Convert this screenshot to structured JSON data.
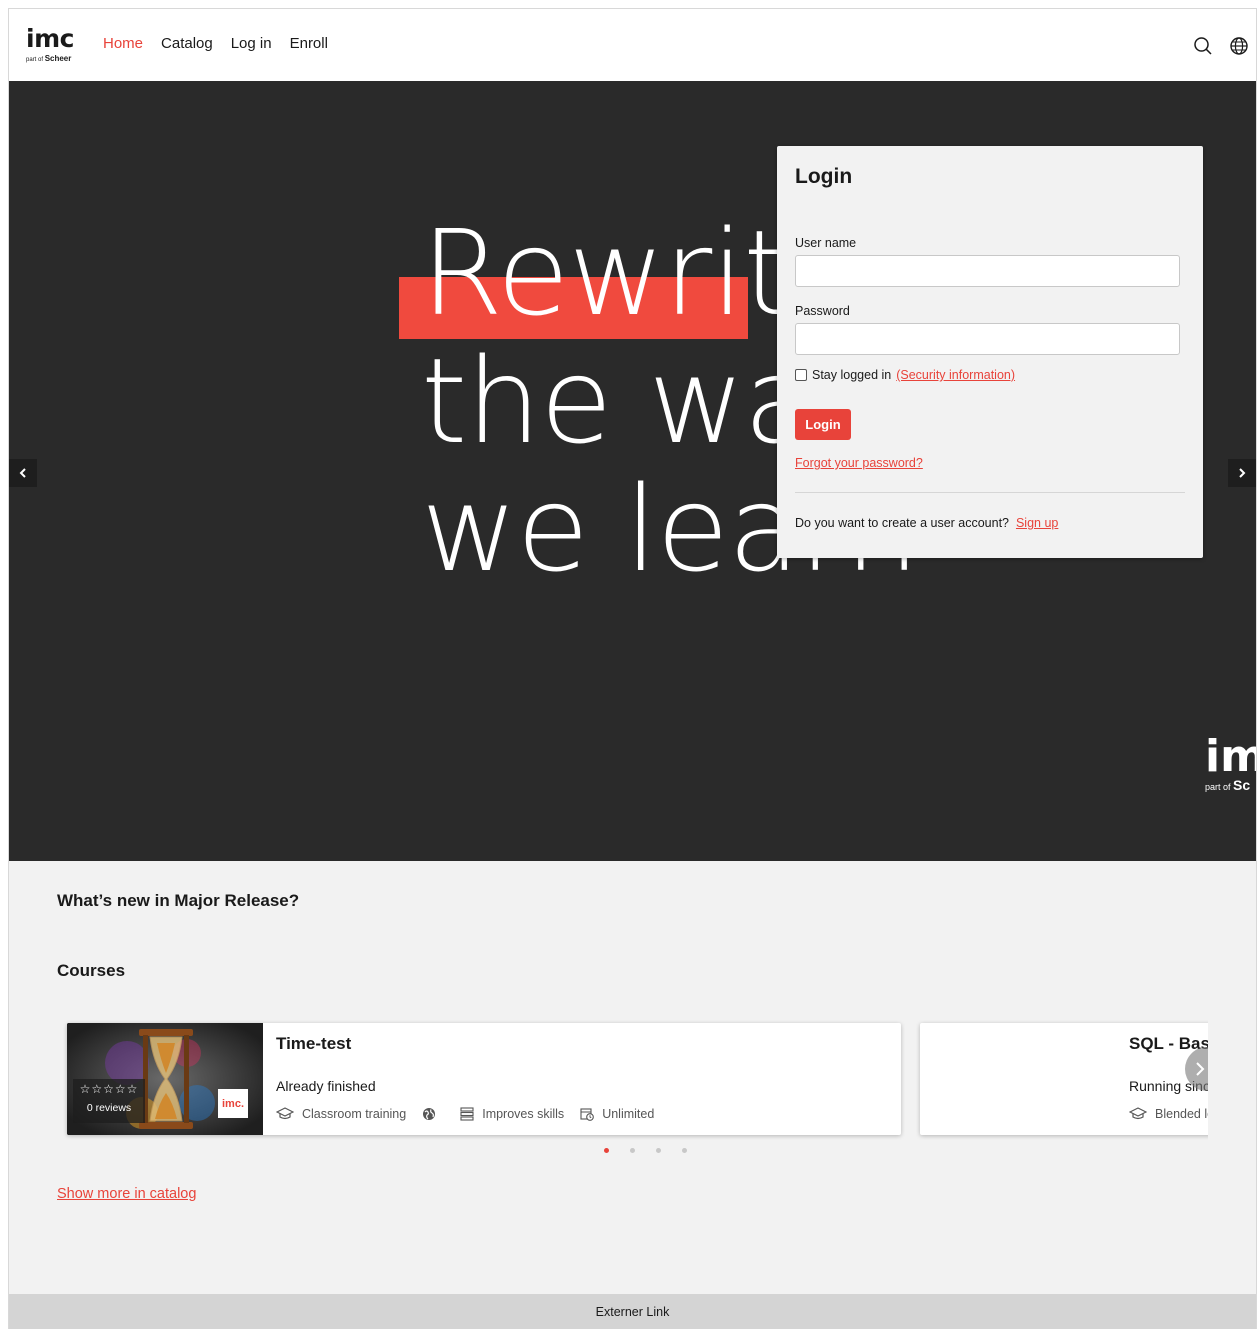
{
  "header": {
    "logo_text": "imc",
    "logo_sub_prefix": "part of",
    "logo_sub_brand": "Scheer",
    "nav": [
      {
        "label": "Home",
        "active": true
      },
      {
        "label": "Catalog"
      },
      {
        "label": "Log in"
      },
      {
        "label": "Enroll"
      }
    ],
    "icons": [
      "search-icon",
      "globe-icon"
    ]
  },
  "hero": {
    "headline_line1": "Rewrit",
    "headline_line2": "the wa",
    "headline_line3": "we learn",
    "logo_text": "im",
    "logo_sub_prefix": "part of",
    "logo_sub_brand": "Sc",
    "accent_color": "#f04a3e"
  },
  "login": {
    "title": "Login",
    "username_label": "User name",
    "username_value": "",
    "password_label": "Password",
    "password_value": "",
    "stay_logged_in_label": "Stay logged in",
    "security_link": "(Security information)",
    "login_button": "Login",
    "forgot_link": "Forgot your password?",
    "signup_prompt": "Do you want to create a user account?",
    "signup_link": "Sign up"
  },
  "sections": {
    "release_title": "What’s new in Major Release?",
    "courses_title": "Courses"
  },
  "courses": [
    {
      "title": "Time-test",
      "status": "Already finished",
      "reviews": "0 reviews",
      "rating_stars": "☆☆☆☆☆",
      "badge": "imc.",
      "type": "Classroom training",
      "goal": "Improves skills",
      "duration": "Unlimited"
    },
    {
      "title": "SQL - Basi",
      "status": "Running sinc",
      "type": "Blended le"
    }
  ],
  "carousel": {
    "pages": 4,
    "active_page": 1
  },
  "show_more": "Show more in catalog",
  "footer": {
    "link": "Externer Link"
  },
  "colors": {
    "brand_red": "#e8433a",
    "hero_bg": "#2a2a2a",
    "page_bg": "#f2f2f2"
  }
}
